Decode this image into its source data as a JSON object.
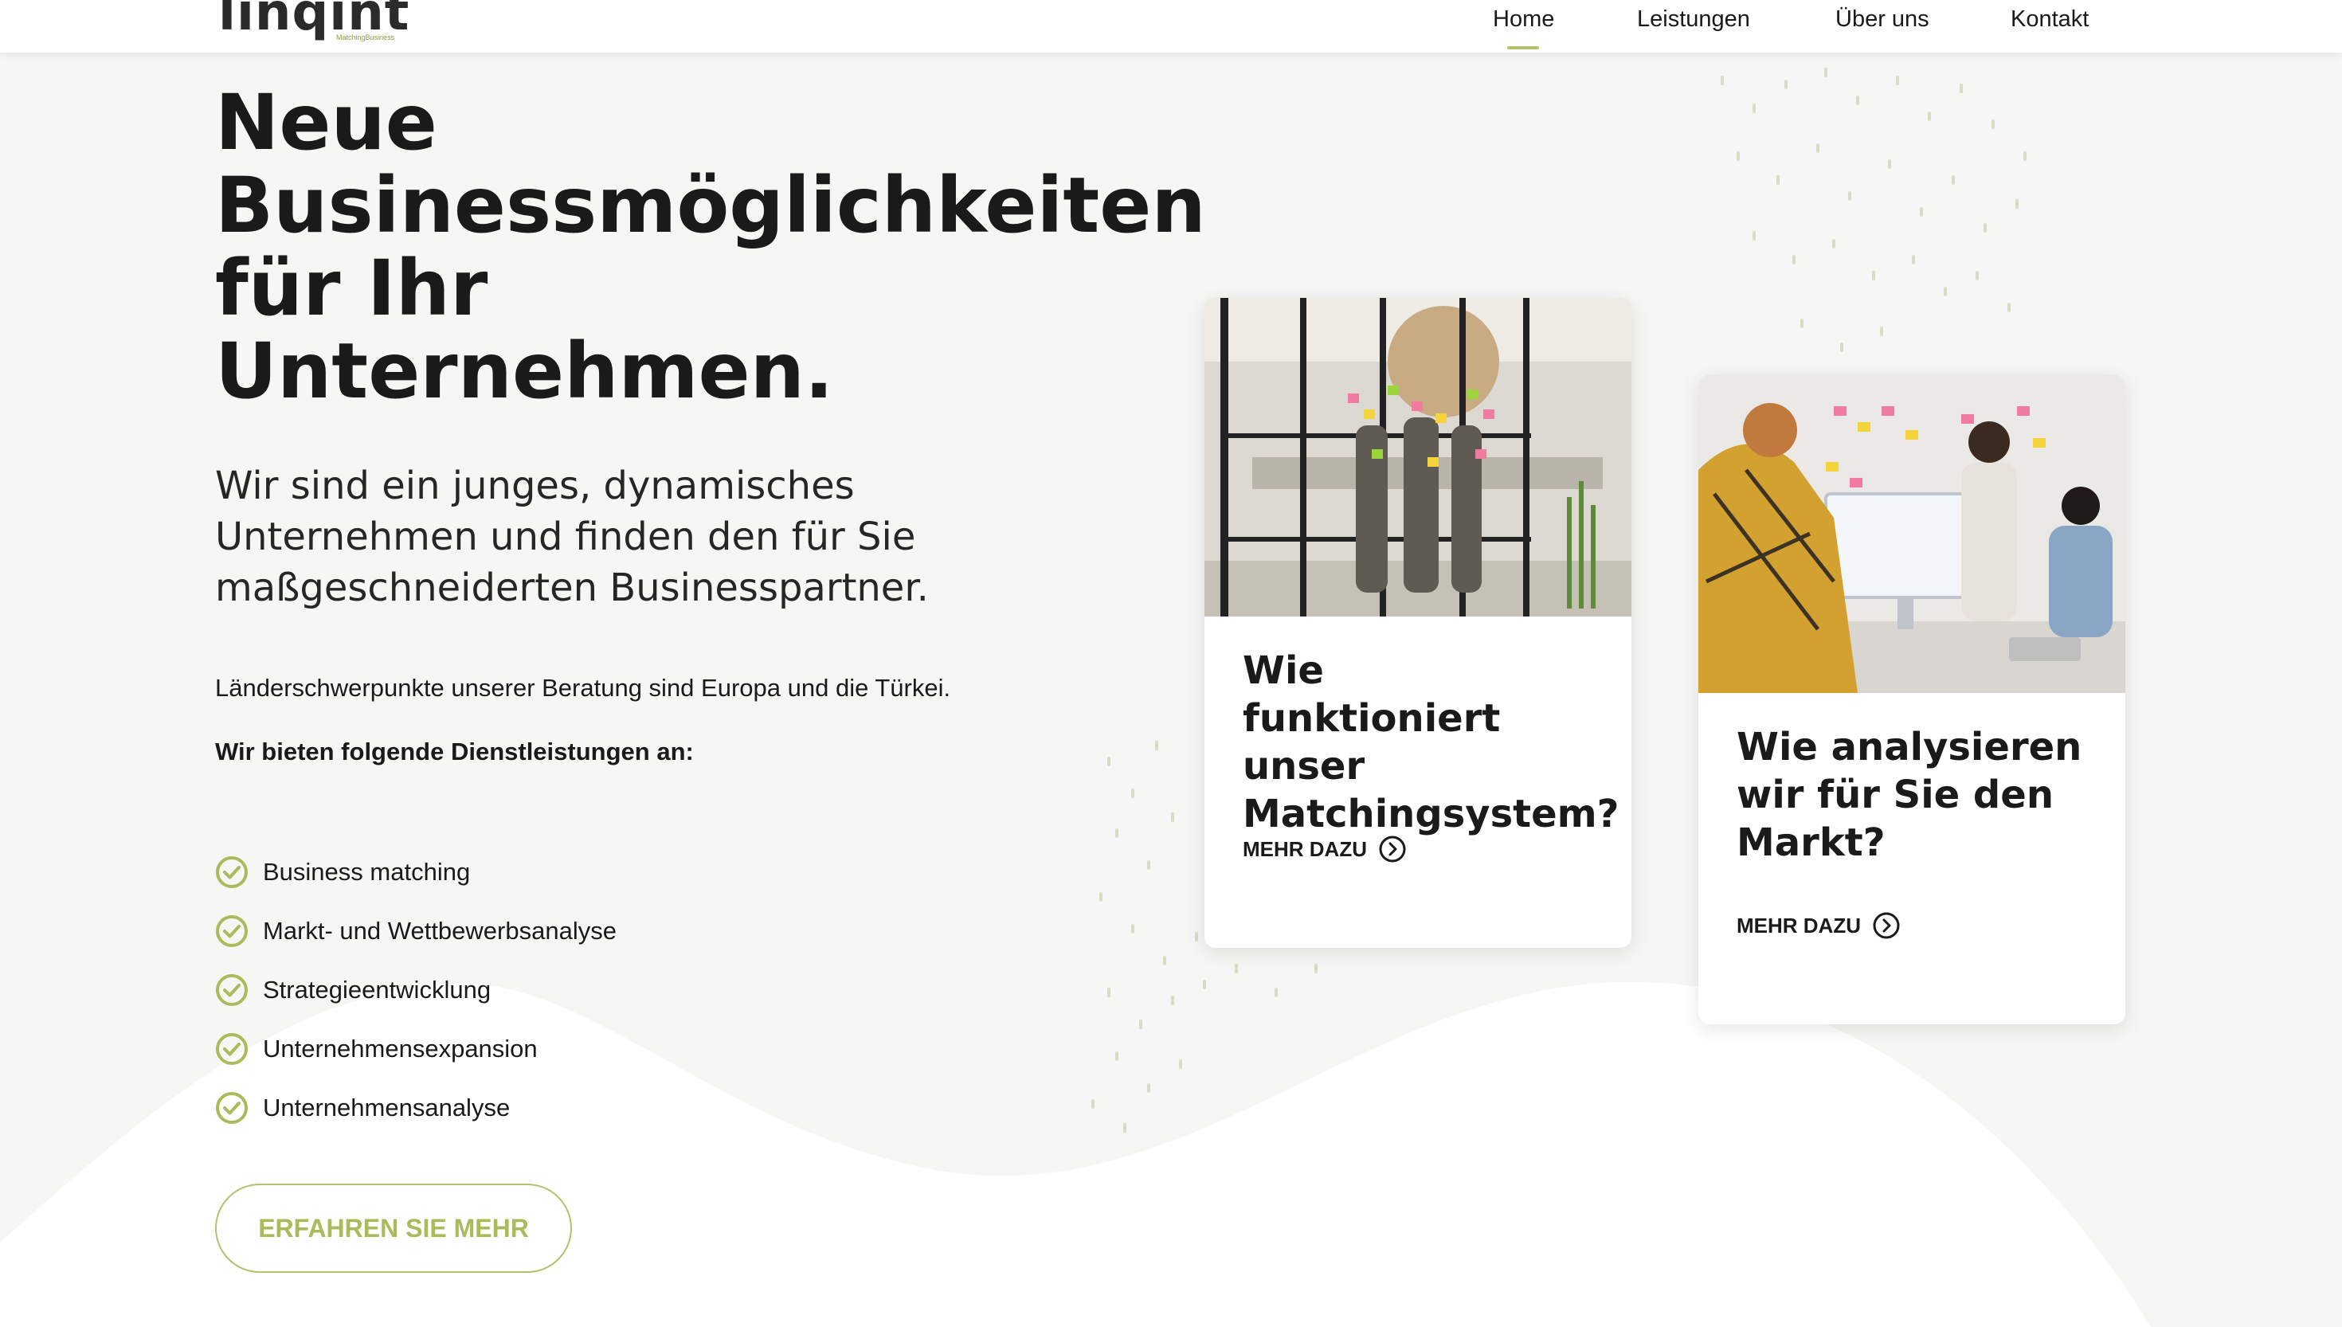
{
  "header": {
    "logo_text": "linqint",
    "logo_tagline": "MatchingBusiness",
    "nav": [
      {
        "label": "Home",
        "active": true
      },
      {
        "label": "Leistungen"
      },
      {
        "label": "Über uns"
      },
      {
        "label": "Kontakt"
      }
    ]
  },
  "hero": {
    "title_lines": [
      "Neue",
      "Businessmöglichkeiten",
      "für Ihr",
      "Unternehmen."
    ],
    "subtitle_lines": [
      "Wir sind ein junges, dynamisches",
      "Unternehmen und finden den für Sie",
      "maßgeschneiderten Businesspartner."
    ],
    "paragraph": "Länderschwerpunkte unserer Beratung sind Europa und die Türkei.",
    "services_heading": "Wir bieten folgende Dienstleistungen an:",
    "services": [
      "Business matching",
      "Markt- und Wettbewerbsanalyse",
      "Strategieentwicklung",
      "Unternehmensexpansion",
      "Unternehmensanalyse"
    ],
    "cta_label": "ERFAHREN SIE MEHR"
  },
  "cards": [
    {
      "title_lines": [
        "Wie funktioniert",
        "unser",
        "Matchingsystem?"
      ],
      "link_label": "MEHR DAZU",
      "image": "office-team-glass-wall-sticky-notes"
    },
    {
      "title_lines": [
        "Wie analysieren",
        "wir für Sie den",
        "Markt?"
      ],
      "link_label": "MEHR DAZU",
      "image": "team-meeting-monitor-sticky-notes"
    }
  ],
  "colors": {
    "accent": "#b4c270",
    "accent_text": "#a9bb5a",
    "background": "#f6f6f4",
    "text": "#1a1a1a"
  },
  "icons": {
    "check": "check-circle-icon",
    "arrow": "arrow-right-circle-icon"
  }
}
